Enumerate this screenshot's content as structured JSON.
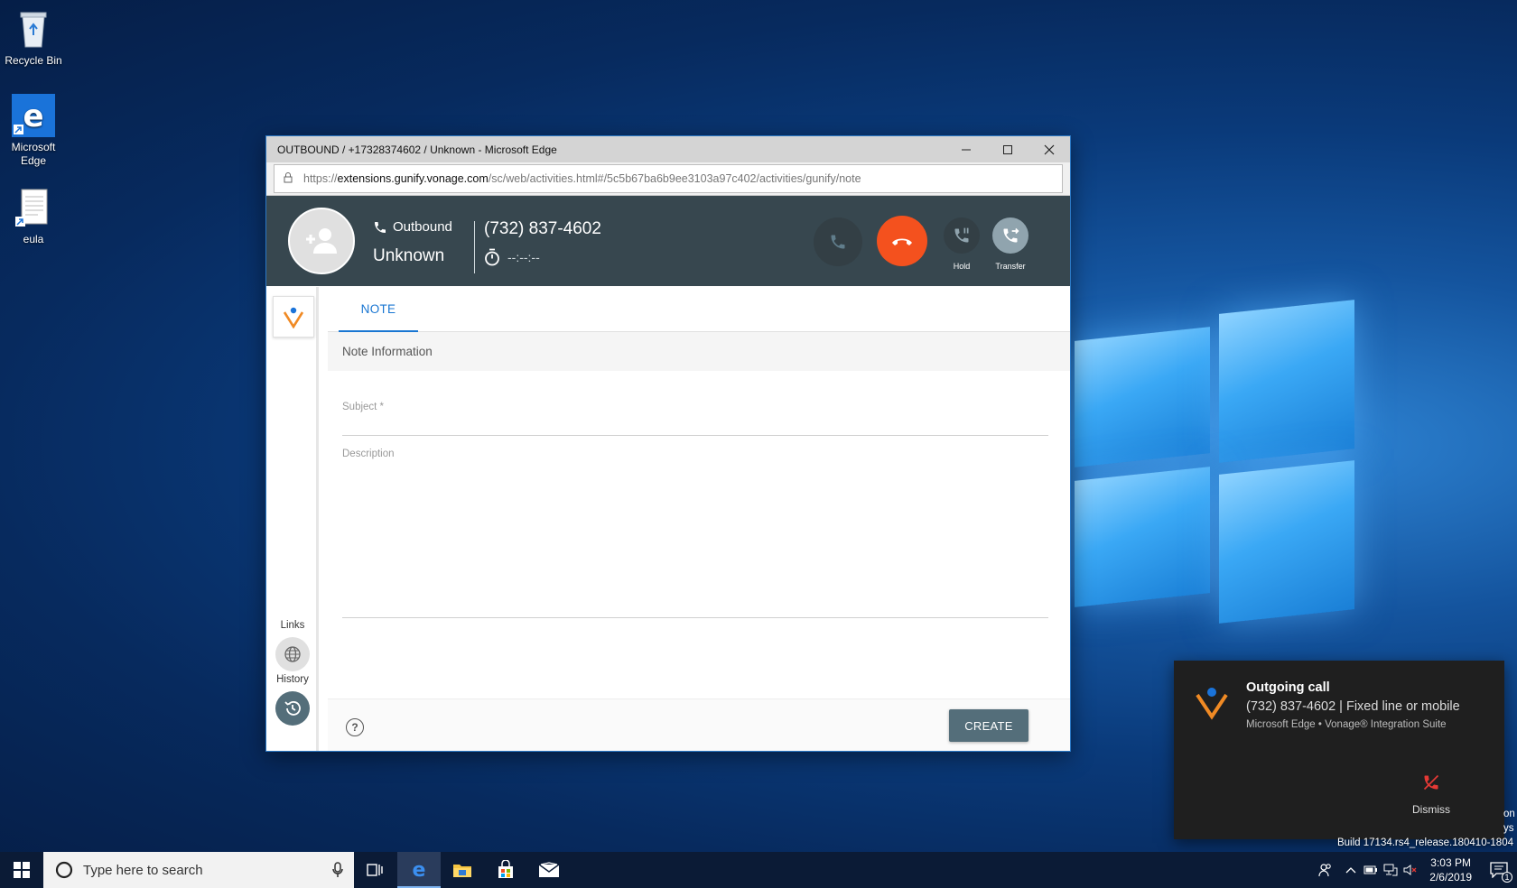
{
  "desktop": {
    "icons": [
      {
        "label": "Recycle Bin"
      },
      {
        "label": "Microsoft Edge"
      },
      {
        "label": "eula"
      }
    ]
  },
  "window": {
    "title": "OUTBOUND / +17328374602 / Unknown - Microsoft Edge",
    "url_scheme": "https://",
    "url_host": "extensions.gunify.vonage.com",
    "url_path": "/sc/web/activities.html#/5c5b67ba6b9ee3103a97c402/activities/gunify/note"
  },
  "call": {
    "direction": "Outbound",
    "contact": "Unknown",
    "number": "(732) 837-4602",
    "timer": "--:--:--",
    "hold_label": "Hold",
    "transfer_label": "Transfer",
    "hangup_color": "#f4511e"
  },
  "rail": {
    "links_label": "Links",
    "history_label": "History"
  },
  "tabs": [
    {
      "label": "NOTE"
    }
  ],
  "form": {
    "section": "Note Information",
    "subject_placeholder": "Subject *",
    "description_placeholder": "Description",
    "create_label": "CREATE",
    "accent": "#1976d2"
  },
  "toast": {
    "title": "Outgoing call",
    "line": "(732) 837-4602 | Fixed line or mobile",
    "source": "Microsoft Edge • Vonage® Integration Suite",
    "dismiss_label": "Dismiss"
  },
  "watermark": {
    "build": "Build 17134.rs4_release.180410-1804",
    "frag1": "on",
    "frag2": "ys"
  },
  "taskbar": {
    "search_placeholder": "Type here to search",
    "time": "3:03 PM",
    "date": "2/6/2019",
    "notification_count": "1"
  }
}
